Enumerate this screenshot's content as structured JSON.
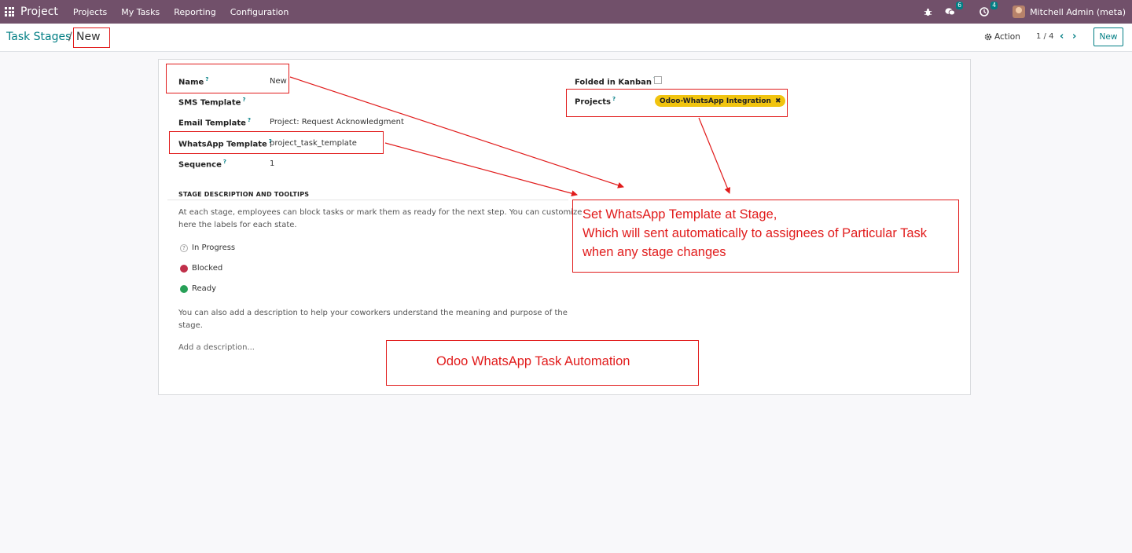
{
  "navbar": {
    "app_name": "Project",
    "menu": [
      "Projects",
      "My Tasks",
      "Reporting",
      "Configuration"
    ],
    "messages_count": "6",
    "activities_count": "4",
    "user_name": "Mitchell Admin (meta)"
  },
  "control_panel": {
    "breadcrumb_parent": "Task Stages",
    "breadcrumb_separator": "/",
    "breadcrumb_current": "New",
    "action_label": "Action",
    "pager": "1 / 4",
    "new_label": "New"
  },
  "form": {
    "name_label": "Name",
    "name_value": "New",
    "sms_label": "SMS Template",
    "email_label": "Email Template",
    "email_value": "Project: Request Acknowledgment",
    "whatsapp_label": "WhatsApp Template",
    "whatsapp_value": "project_task_template",
    "sequence_label": "Sequence",
    "sequence_value": "1",
    "folded_label": "Folded in Kanban",
    "projects_label": "Projects",
    "project_tag": "Odoo-WhatsApp Integration",
    "help_mark": "?",
    "section_title": "STAGE DESCRIPTION AND TOOLTIPS",
    "intro_line1": "At each stage, employees can block tasks or mark them as ready for the next step. You can customize",
    "intro_line2": "here the labels for each state.",
    "state_in_progress": "In Progress",
    "state_blocked": "Blocked",
    "state_ready": "Ready",
    "desc_line1": "You can also add a description to help your coworkers understand the meaning and purpose of the",
    "desc_line2": "stage.",
    "add_description": "Add a description..."
  },
  "annotations": {
    "callout_line1": "Set WhatsApp Template at Stage,",
    "callout_line2": "Which will sent automatically to assignees of Particular Task",
    "callout_line3": "when any stage changes",
    "footer_label": "Odoo WhatsApp Task Automation"
  },
  "colors": {
    "navbar": "#71506a",
    "accent": "#017e84",
    "annotation": "#e11c1c",
    "tag": "#f1c40f",
    "blocked": "#c0304a",
    "ready": "#27a057"
  }
}
